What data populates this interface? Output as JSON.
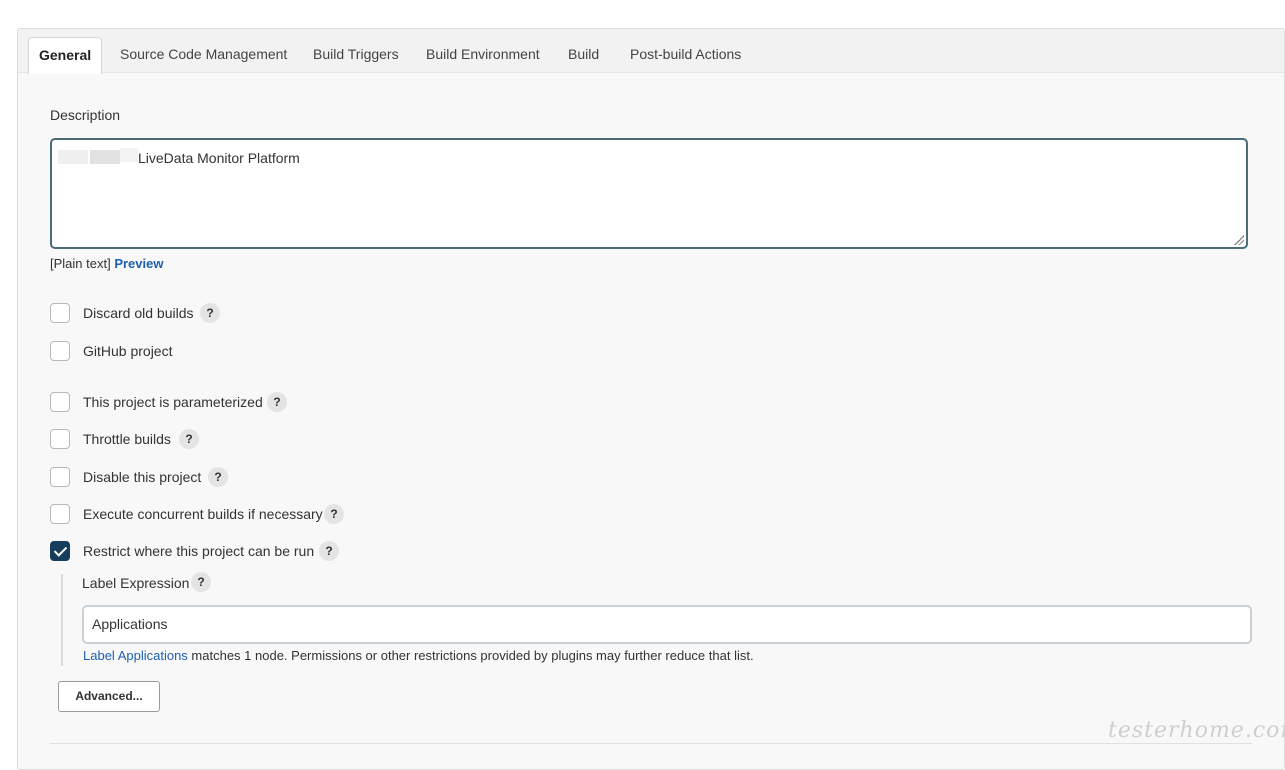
{
  "tabs": [
    {
      "label": "General",
      "active": true
    },
    {
      "label": "Source Code Management",
      "active": false
    },
    {
      "label": "Build Triggers",
      "active": false
    },
    {
      "label": "Build Environment",
      "active": false
    },
    {
      "label": "Build",
      "active": false
    },
    {
      "label": "Post-build Actions",
      "active": false
    }
  ],
  "description": {
    "label": "Description",
    "value": "LiveData Monitor Platform",
    "format_text": "[Plain text]",
    "preview_link": "Preview"
  },
  "options": [
    {
      "label": "Discard old builds",
      "checked": false,
      "help": "?"
    },
    {
      "label": "GitHub project",
      "checked": false,
      "help": ""
    },
    {
      "label": "This project is parameterized",
      "checked": false,
      "help": "?"
    },
    {
      "label": "Throttle builds",
      "checked": false,
      "help": "?"
    },
    {
      "label": "Disable this project",
      "checked": false,
      "help": "?"
    },
    {
      "label": "Execute concurrent builds if necessary",
      "checked": false,
      "help": "?"
    },
    {
      "label": "Restrict where this project can be run",
      "checked": true,
      "help": "?"
    }
  ],
  "label_expression": {
    "label": "Label Expression",
    "help": "?",
    "value": "Applications",
    "match_link": "Label Applications",
    "match_text": " matches 1 node. Permissions or other restrictions provided by plugins may further reduce that list."
  },
  "advanced_button": "Advanced...",
  "watermark": "testerhome.com",
  "colors": {
    "checkbox_checked": "#173d5c",
    "link": "#1e60b0",
    "textarea_border": "#4a6b78"
  }
}
